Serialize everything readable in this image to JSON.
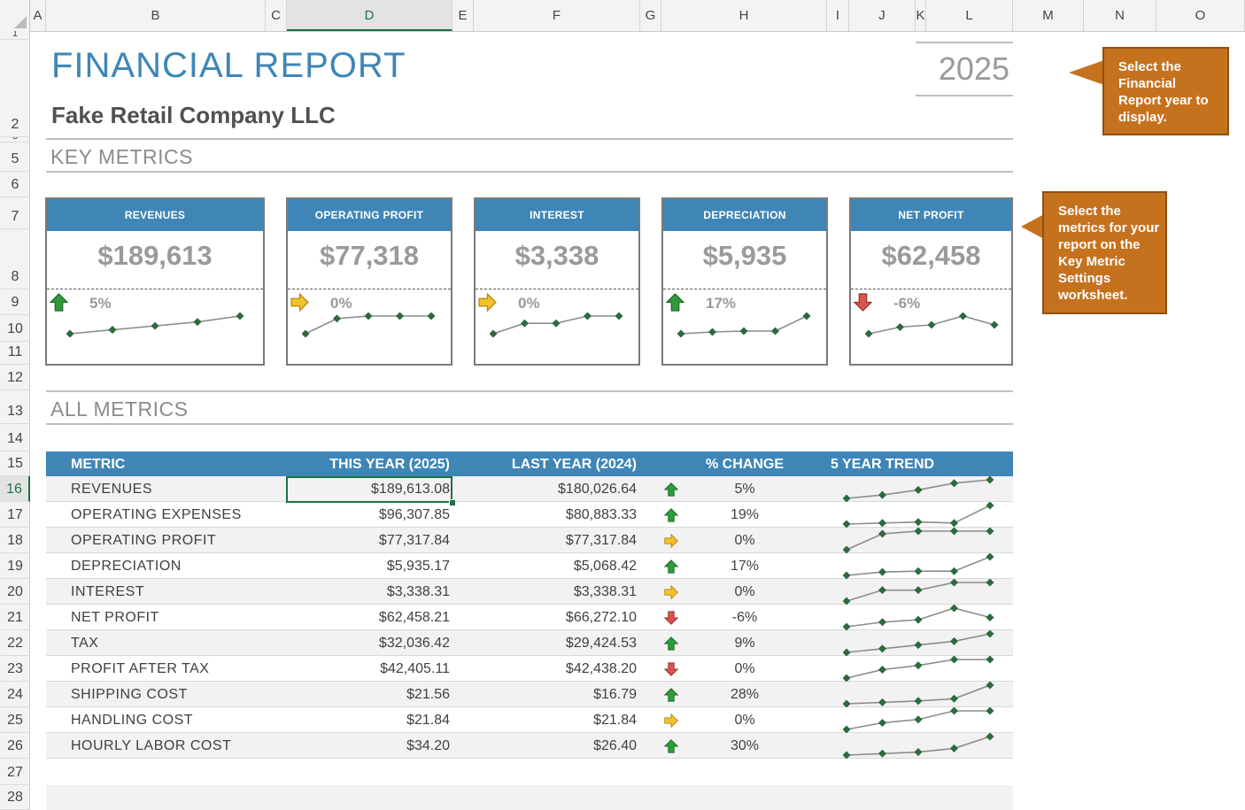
{
  "columns": [
    "A",
    "B",
    "C",
    "D",
    "E",
    "F",
    "G",
    "H",
    "I",
    "J",
    "K",
    "L",
    "M",
    "N",
    "O"
  ],
  "selected_column": "D",
  "rows": [
    "1",
    "2",
    "3",
    "5",
    "6",
    "7",
    "8",
    "9",
    "10",
    "11",
    "12",
    "13",
    "14",
    "15",
    "16",
    "17",
    "18",
    "19",
    "20",
    "21",
    "22",
    "23",
    "24",
    "25",
    "26",
    "27",
    "28"
  ],
  "selected_row": "16",
  "report": {
    "title": "FINANCIAL  REPORT",
    "company": "Fake Retail Company LLC",
    "year": "2025"
  },
  "sections": {
    "key_metrics": "KEY  METRICS",
    "all_metrics": "ALL  METRICS"
  },
  "callouts": {
    "year": "Select the Financial Report year to display.",
    "metrics": "Select the metrics for your report on the Key Metric Settings worksheet."
  },
  "colors": {
    "accent": "#3f86b7",
    "callout": "#c5721f",
    "up": "#2e9b3c",
    "flat": "#f2c12e",
    "down": "#d9534f",
    "spark_line": "#8c8c8c",
    "spark_marker": "#2d6a3c"
  },
  "kpis": [
    {
      "label": "REVENUES",
      "value": "$189,613",
      "change": "5%",
      "trend": "up",
      "spark": [
        180,
        182,
        184,
        186,
        189
      ]
    },
    {
      "label": "OPERATING PROFIT",
      "value": "$77,318",
      "change": "0%",
      "trend": "flat",
      "spark": [
        70,
        76,
        77,
        77,
        77
      ]
    },
    {
      "label": "INTEREST",
      "value": "$3,338",
      "change": "0%",
      "trend": "flat",
      "spark": [
        3.0,
        3.2,
        3.2,
        3.34,
        3.34
      ]
    },
    {
      "label": "DEPRECIATION",
      "value": "$5,935",
      "change": "17%",
      "trend": "up",
      "spark": [
        4.9,
        5.0,
        5.05,
        5.05,
        5.9
      ]
    },
    {
      "label": "NET PROFIT",
      "value": "$62,458",
      "change": "-6%",
      "trend": "down",
      "spark": [
        58,
        61,
        62,
        66,
        62
      ]
    }
  ],
  "table": {
    "headers": {
      "metric": "METRIC",
      "this_year": "THIS YEAR (2025)",
      "last_year": "LAST YEAR (2024)",
      "pct_change": "% CHANGE",
      "trend": "5 YEAR TREND"
    },
    "rows": [
      {
        "metric": "REVENUES",
        "this_year": "$189,613.08",
        "last_year": "$180,026.64",
        "trend": "up",
        "pct": "5%",
        "spark": [
          175,
          177,
          180,
          184,
          186
        ]
      },
      {
        "metric": "OPERATING  EXPENSES",
        "this_year": "$96,307.85",
        "last_year": "$80,883.33",
        "trend": "up",
        "pct": "19%",
        "spark": [
          78,
          79,
          80,
          79,
          96
        ]
      },
      {
        "metric": "OPERATING  PROFIT",
        "this_year": "$77,317.84",
        "last_year": "$77,317.84",
        "trend": "flat",
        "pct": "0%",
        "spark": [
          70,
          76,
          77,
          77,
          77
        ]
      },
      {
        "metric": "DEPRECIATION",
        "this_year": "$5,935.17",
        "last_year": "$5,068.42",
        "trend": "up",
        "pct": "17%",
        "spark": [
          4.8,
          5.0,
          5.05,
          5.05,
          5.9
        ]
      },
      {
        "metric": "INTEREST",
        "this_year": "$3,338.31",
        "last_year": "$3,338.31",
        "trend": "flat",
        "pct": "0%",
        "spark": [
          3.0,
          3.2,
          3.2,
          3.34,
          3.34
        ]
      },
      {
        "metric": "NET  PROFIT",
        "this_year": "$62,458.21",
        "last_year": "$66,272.10",
        "trend": "down",
        "pct": "-6%",
        "spark": [
          58,
          60,
          61,
          66,
          62
        ]
      },
      {
        "metric": "TAX",
        "this_year": "$32,036.42",
        "last_year": "$29,424.53",
        "trend": "up",
        "pct": "9%",
        "spark": [
          27,
          28,
          29,
          30,
          32
        ]
      },
      {
        "metric": "PROFIT  AFTER  TAX",
        "this_year": "$42,405.11",
        "last_year": "$42,438.20",
        "trend": "down",
        "pct": "0%",
        "spark": [
          38,
          40,
          41,
          42.4,
          42.4
        ]
      },
      {
        "metric": "SHIPPING  COST",
        "this_year": "$21.56",
        "last_year": "$16.79",
        "trend": "up",
        "pct": "28%",
        "spark": [
          15,
          15.5,
          16,
          16.8,
          21.6
        ]
      },
      {
        "metric": "HANDLING  COST",
        "this_year": "$21.84",
        "last_year": "$21.84",
        "trend": "flat",
        "pct": "0%",
        "spark": [
          19,
          20,
          20.5,
          21.8,
          21.8
        ]
      },
      {
        "metric": "HOURLY  LABOR  COST",
        "this_year": "$34.20",
        "last_year": "$26.40",
        "trend": "up",
        "pct": "30%",
        "spark": [
          22,
          23,
          24,
          26.4,
          34.2
        ]
      }
    ]
  }
}
